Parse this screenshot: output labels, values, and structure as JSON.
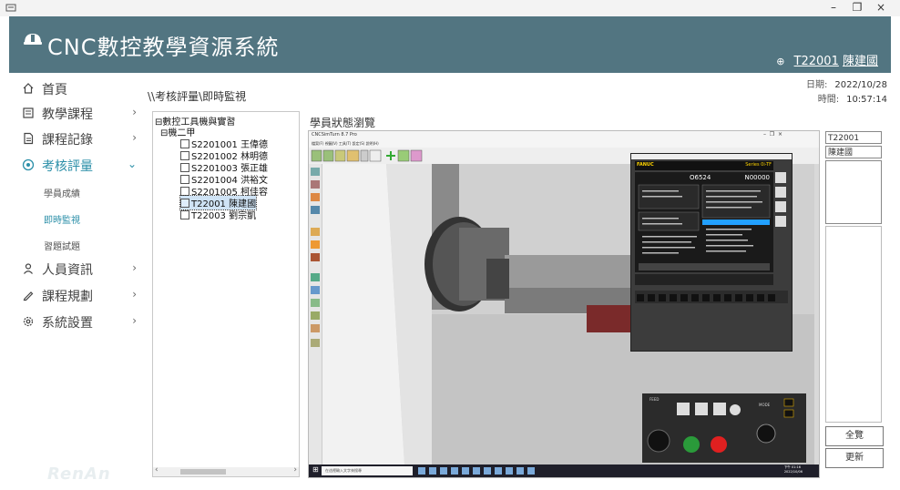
{
  "window": {
    "minimize": "–",
    "maximize": "❐",
    "close": "×"
  },
  "header": {
    "title": "CNC數控教學資源系統",
    "user_id": "T22001",
    "user_name": "陳建國"
  },
  "sidebar": {
    "items": [
      {
        "label": "首頁",
        "icon": "home-icon"
      },
      {
        "label": "教學課程",
        "icon": "book-icon",
        "chevron": "›"
      },
      {
        "label": "課程記錄",
        "icon": "document-icon",
        "chevron": "›"
      },
      {
        "label": "考核評量",
        "icon": "target-icon",
        "chevron": "⌄"
      },
      {
        "label": "人員資訊",
        "icon": "person-icon",
        "chevron": "›"
      },
      {
        "label": "課程規劃",
        "icon": "pencil-icon",
        "chevron": "›"
      },
      {
        "label": "系統設置",
        "icon": "gear-icon",
        "chevron": "›"
      }
    ],
    "subitems": [
      "學員成績",
      "即時監視",
      "習題試題"
    ],
    "active_item": "考核評量",
    "active_subitem": "即時監視",
    "accent": "#2b8fa8",
    "watermark": "RenAn"
  },
  "main": {
    "breadcrumb": "\\\\考核評量\\即時監視",
    "date_label": "日期:",
    "date": "2022/10/28",
    "time_label": "時間:",
    "time": "10:57:14",
    "tree": {
      "root": "數控工具機與實習",
      "group": "機二甲",
      "students": [
        "S2201001 王偉德",
        "S2201002 林明德",
        "S2201003 張正雄",
        "S2201004 洪裕文",
        "S2201005 柯佳容",
        "T22001 陳建國",
        "T22003 劉宗凱"
      ],
      "selected": "T22001 陳建國"
    },
    "panel_title": "學員狀態瀏覽",
    "viewer": {
      "app_title": "CNCSimTurn 8.7 Pro",
      "menu": "檔案(F)  視圖(V)  工具(T)  設定(S)  說明(H)",
      "ctrl_brand": "FANUC",
      "ctrl_model": "Series 0i-TF",
      "prog_no": "O6524",
      "seq_no": "N00000",
      "taskbar_search": "在這裡輸入文字來搜尋",
      "clock": "下午 01:16\n2022/10/06",
      "mode_label": "MODE",
      "feed_label": "FEED"
    },
    "right": {
      "user_id": "T22001",
      "user_name": "陳建國",
      "btn_browse": "全覽",
      "btn_refresh": "更新"
    }
  },
  "colors": {
    "header_bg": "#527581",
    "accent": "#2b8fa8",
    "ctrl_bg": "#3c3c3c",
    "screen_bg": "#1a1a1a",
    "screen_text": "#ffffff",
    "highlight": "#22a0ff"
  }
}
